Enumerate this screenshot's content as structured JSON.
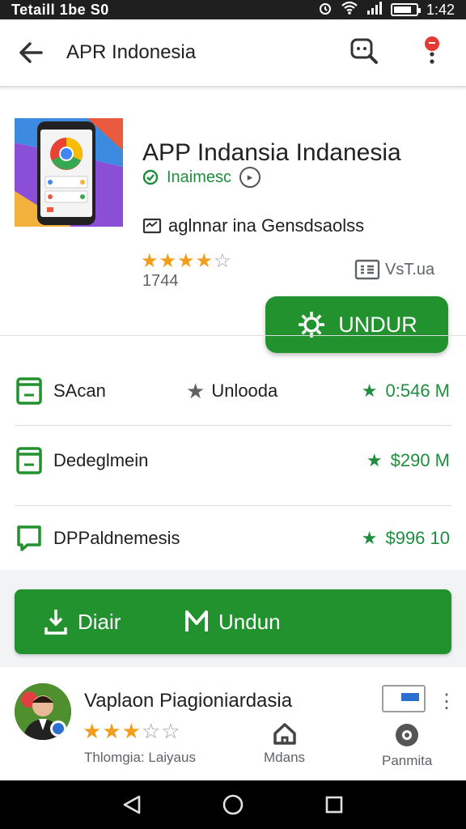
{
  "status_bar": {
    "left_text": "Tetaill 1be S0",
    "time": "1:42",
    "battery_level": 0.8
  },
  "app_bar": {
    "title": "APR Indonesia",
    "icons": [
      "back-arrow-icon",
      "search-icon",
      "notification-icon"
    ]
  },
  "app": {
    "name": "APP Indansia Indanesia",
    "developer": "Inaimesc",
    "tagline": "aglnnar ina Gensdsaolss",
    "rating": 4,
    "rating_max": 5,
    "reviews": "1744",
    "version_label": "VsT.ua",
    "install_label": "UNDUR"
  },
  "details": [
    {
      "label": "SAcan",
      "mid_label": "Unlooda",
      "value": "0:546 M",
      "icon": "folder-icon"
    },
    {
      "label": "Dedeglmein",
      "mid_label": "",
      "value": "$290 M",
      "icon": "folder-icon"
    },
    {
      "label": "DPPaldnemesis",
      "mid_label": "",
      "value": "$996 10",
      "icon": "chat-icon"
    }
  ],
  "actions": {
    "primary_label": "Diair",
    "secondary_label": "Undun"
  },
  "review": {
    "name": "Vaplaon Piagioniardasia",
    "rating": 3,
    "rating_max": 5,
    "meta": "Thlomgia:  Laiyaus",
    "action_1": "Mdans",
    "action_2": "Panmita"
  },
  "colors": {
    "accent_green": "#22922f",
    "star": "#f29d1c",
    "dev_green": "#1e8e3e"
  }
}
